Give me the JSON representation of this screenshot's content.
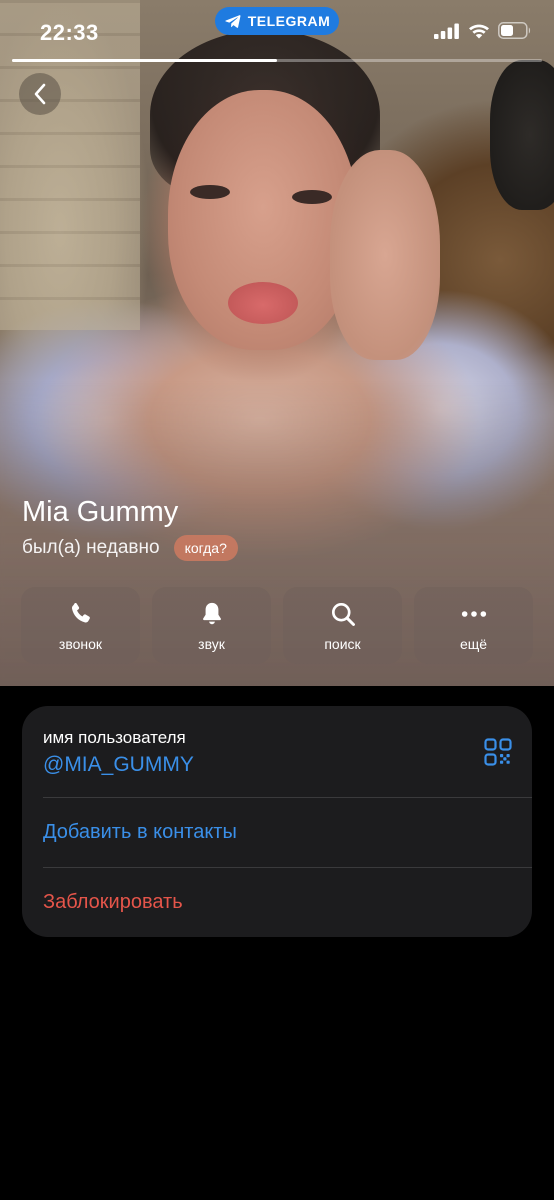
{
  "status_bar": {
    "time": "22:33",
    "app_pill_label": "TELEGRAM",
    "icons": [
      "signal-icon",
      "wifi-icon",
      "battery-icon"
    ],
    "story_progress": 0.5
  },
  "profile": {
    "name": "Mia Gummy",
    "status": "был(а) недавно",
    "when_badge": "когда?"
  },
  "actions": [
    {
      "label": "звонок",
      "icon": "phone-icon"
    },
    {
      "label": "звук",
      "icon": "bell-icon"
    },
    {
      "label": "поиск",
      "icon": "search-icon"
    },
    {
      "label": "ещё",
      "icon": "more-icon"
    }
  ],
  "info": {
    "username_label": "имя пользователя",
    "username_value": "@MIA_GUMMY",
    "add_contact": "Добавить в контакты",
    "block": "Заблокировать"
  },
  "colors": {
    "accent_blue": "#3a8fe8",
    "danger_red": "#e5554a",
    "pill_blue": "#1f7be0",
    "card_bg": "#1c1c1e",
    "badge": "#ce7a60"
  }
}
